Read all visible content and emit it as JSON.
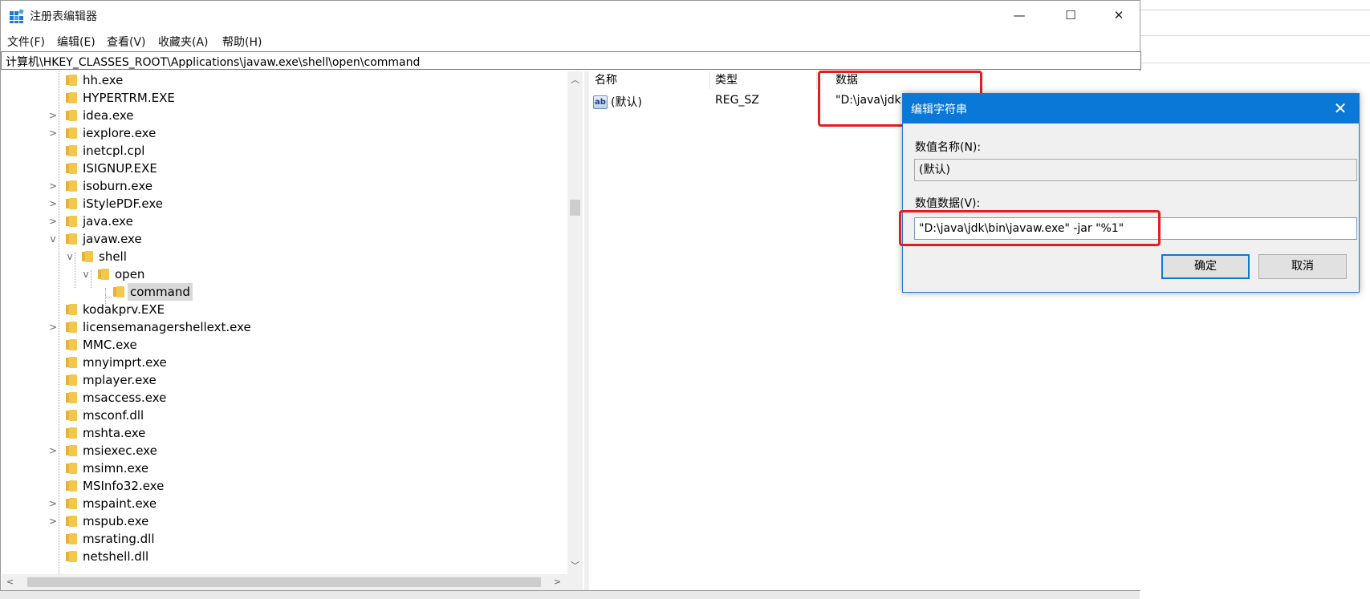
{
  "window": {
    "title": "注册表编辑器",
    "controls": {
      "minimize": "—",
      "maximize": "☐",
      "close": "✕"
    }
  },
  "menu": [
    "文件(F)",
    "编辑(E)",
    "查看(V)",
    "收藏夹(A)",
    "帮助(H)"
  ],
  "address": "计算机\\HKEY_CLASSES_ROOT\\Applications\\javaw.exe\\shell\\open\\command",
  "tree": {
    "items": [
      {
        "label": "hh.exe",
        "expander": ""
      },
      {
        "label": "HYPERTRM.EXE",
        "expander": ""
      },
      {
        "label": "idea.exe",
        "expander": ">"
      },
      {
        "label": "iexplore.exe",
        "expander": ">"
      },
      {
        "label": "inetcpl.cpl",
        "expander": ""
      },
      {
        "label": "ISIGNUP.EXE",
        "expander": ""
      },
      {
        "label": "isoburn.exe",
        "expander": ">"
      },
      {
        "label": "iStylePDF.exe",
        "expander": ">"
      },
      {
        "label": "java.exe",
        "expander": ">"
      },
      {
        "label": "javaw.exe",
        "expander": "v"
      },
      {
        "label": "shell",
        "expander": "v"
      },
      {
        "label": "open",
        "expander": "v"
      },
      {
        "label": "command",
        "expander": "",
        "selected": true
      },
      {
        "label": "kodakprv.EXE",
        "expander": ""
      },
      {
        "label": "licensemanagershellext.exe",
        "expander": ">"
      },
      {
        "label": "MMC.exe",
        "expander": ""
      },
      {
        "label": "mnyimprt.exe",
        "expander": ""
      },
      {
        "label": "mplayer.exe",
        "expander": ""
      },
      {
        "label": "msaccess.exe",
        "expander": ""
      },
      {
        "label": "msconf.dll",
        "expander": ""
      },
      {
        "label": "mshta.exe",
        "expander": ""
      },
      {
        "label": "msiexec.exe",
        "expander": ">"
      },
      {
        "label": "msimn.exe",
        "expander": ""
      },
      {
        "label": "MSInfo32.exe",
        "expander": ""
      },
      {
        "label": "mspaint.exe",
        "expander": ">"
      },
      {
        "label": "mspub.exe",
        "expander": ">"
      },
      {
        "label": "msrating.dll",
        "expander": ""
      },
      {
        "label": "netshell.dll",
        "expander": ""
      }
    ]
  },
  "list": {
    "headers": {
      "name": "名称",
      "type": "类型",
      "data": "数据"
    },
    "rows": [
      {
        "icon": "ab",
        "name": "(默认)",
        "type": "REG_SZ",
        "data": "\"D:\\java\\jdk"
      }
    ]
  },
  "dialog": {
    "title": "编辑字符串",
    "name_label": "数值名称(N):",
    "name_value": "(默认)",
    "data_label": "数值数据(V):",
    "data_value": "\"D:\\java\\jdk\\bin\\javaw.exe\" -jar \"%1\"",
    "ok": "确定",
    "cancel": "取消",
    "close": "✕"
  },
  "scroll": {
    "up": "︿",
    "down": "﹀",
    "left": "<",
    "right": ">"
  },
  "colors": {
    "accent": "#0a78d7",
    "highlight": "#e02020",
    "folder": "#f3c74e"
  }
}
